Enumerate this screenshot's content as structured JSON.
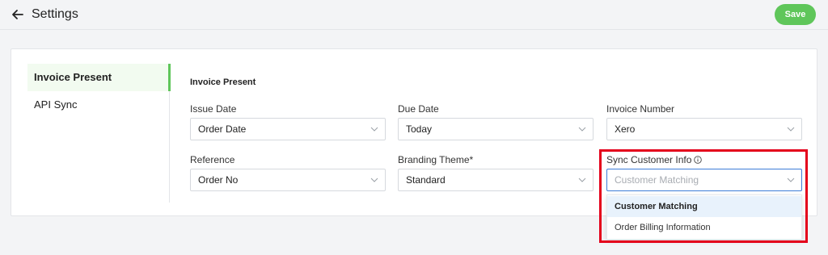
{
  "header": {
    "title": "Settings",
    "save_label": "Save"
  },
  "sidebar": {
    "items": [
      {
        "label": "Invoice Present",
        "active": true
      },
      {
        "label": "API Sync",
        "active": false
      }
    ]
  },
  "section": {
    "title": "Invoice Present"
  },
  "fields": {
    "issue_date": {
      "label": "Issue Date",
      "value": "Order Date"
    },
    "due_date": {
      "label": "Due Date",
      "value": "Today"
    },
    "invoice_number": {
      "label": "Invoice Number",
      "value": "Xero"
    },
    "reference": {
      "label": "Reference",
      "value": "Order No"
    },
    "branding_theme": {
      "label": "Branding Theme*",
      "value": "Standard"
    },
    "sync_customer_info": {
      "label": "Sync Customer Info",
      "placeholder": "Customer Matching"
    }
  },
  "dropdown": {
    "options": [
      {
        "label": "Customer Matching",
        "selected": true
      },
      {
        "label": "Order Billing Information",
        "selected": false
      }
    ]
  },
  "colors": {
    "accent": "#5fc65a",
    "highlight": "#e4001b",
    "focus": "#3d7dd8"
  },
  "icons": [
    "arrow-left-icon",
    "chevron-down-icon",
    "info-icon"
  ]
}
